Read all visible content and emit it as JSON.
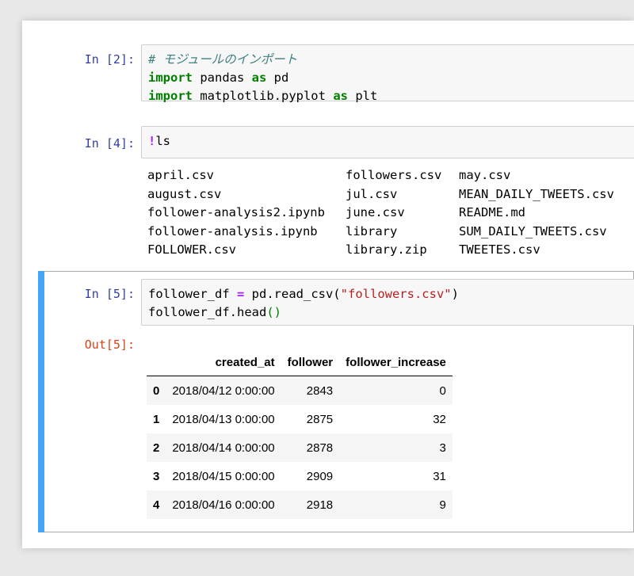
{
  "cells": {
    "cell1": {
      "prompt": "In [2]:",
      "comment": "# モジュールのインポート",
      "line2": {
        "kw1": "import",
        "mod": " pandas ",
        "kw2": "as",
        "alias": " pd"
      },
      "line3": {
        "kw1": "import",
        "mod": " matplotlib.pyplot ",
        "kw2": "as",
        "alias": " plt"
      }
    },
    "cell2": {
      "prompt": "In [4]:",
      "bang": "!",
      "cmd": "ls",
      "files_col1": [
        "april.csv",
        "august.csv",
        "follower-analysis2.ipynb",
        "follower-analysis.ipynb",
        "FOLLOWER.csv"
      ],
      "files_col2": [
        "followers.csv",
        "jul.csv",
        "june.csv",
        "library",
        "library.zip"
      ],
      "files_col3": [
        "may.csv",
        "MEAN_DAILY_TWEETS.csv",
        "README.md",
        "SUM_DAILY_TWEETS.csv",
        "TWEETES.csv"
      ]
    },
    "cell3": {
      "prompt": "In [5]:",
      "out_prompt": "Out[5]:",
      "line1": {
        "var": "follower_df ",
        "eq": "=",
        "call": " pd.read_csv(",
        "str": "\"followers.csv\"",
        "close": ")"
      },
      "line2": {
        "call": "follower_df.head",
        "parens": "()"
      },
      "table": {
        "columns": [
          "",
          "created_at",
          "follower",
          "follower_increase"
        ],
        "rows": [
          [
            "0",
            "2018/04/12 0:00:00",
            "2843",
            "0"
          ],
          [
            "1",
            "2018/04/13 0:00:00",
            "2875",
            "32"
          ],
          [
            "2",
            "2018/04/14 0:00:00",
            "2878",
            "3"
          ],
          [
            "3",
            "2018/04/15 0:00:00",
            "2909",
            "31"
          ],
          [
            "4",
            "2018/04/16 0:00:00",
            "2918",
            "9"
          ]
        ]
      }
    }
  }
}
